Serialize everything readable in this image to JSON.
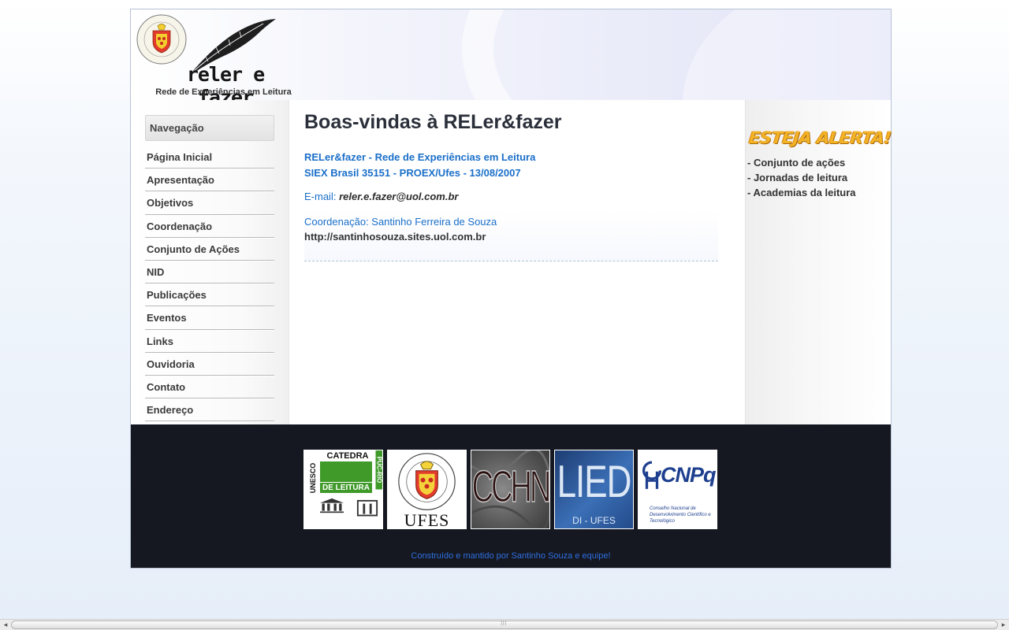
{
  "header": {
    "logo_title": "reler e fazer",
    "logo_subtitle": "Rede de Experiências em Leitura",
    "seal_text": "UNIVERSIDADE FEDERAL DO ESPÍRITO SANTO · DOCETE OMNES GENTES"
  },
  "navigation": {
    "heading": "Navegação",
    "items": [
      {
        "label": "Página Inicial"
      },
      {
        "label": "Apresentação"
      },
      {
        "label": "Objetivos"
      },
      {
        "label": "Coordenação"
      },
      {
        "label": "Conjunto de Ações"
      },
      {
        "label": "NID"
      },
      {
        "label": "Publicações"
      },
      {
        "label": "Eventos"
      },
      {
        "label": "Links"
      },
      {
        "label": "Ouvidoria"
      },
      {
        "label": "Contato"
      },
      {
        "label": "Endereço"
      }
    ]
  },
  "main": {
    "title": "Boas-vindas à RELer&fazer",
    "intro_line1": "RELer&fazer - Rede de Experiências em Leitura",
    "intro_line2": "SIEX Brasil 35151 - PROEX/Ufes - 13/08/2007",
    "email_label": "E-mail:",
    "email_address": "reler.e.fazer@uol.com.br",
    "coordination": "Coordenação: Santinho Ferreira de Souza",
    "site_url": "http://santinhosouza.sites.uol.com.br"
  },
  "sidebar_right": {
    "alert_title": "ESTEJA ALERTA!",
    "items": [
      {
        "label": "- Conjunto de ações"
      },
      {
        "label": "- Jornadas de leitura"
      },
      {
        "label": "- Academias da leitura"
      }
    ]
  },
  "footer": {
    "logos": [
      {
        "name": "unesco-catedra",
        "text_top": "CATEDRA",
        "text_mid": "DE LEITURA",
        "text_side": "UNESCO",
        "text_side2": "PUC-RIO"
      },
      {
        "name": "ufes",
        "text": "UFES"
      },
      {
        "name": "cchn",
        "text": "CCHN"
      },
      {
        "name": "lied",
        "text": "LIED",
        "subtext": "DI - UFES"
      },
      {
        "name": "cnpq",
        "text": "CNPq",
        "subtext": "Conselho Nacional de Desenvolvimento Científico e Tecnológico"
      }
    ],
    "credit": "Construído e mantido por Santinho Souza e equipe!"
  },
  "colors": {
    "link_blue": "#1a6fc9",
    "footer_bg": "#151821",
    "alert_orange": "#f2b326"
  }
}
